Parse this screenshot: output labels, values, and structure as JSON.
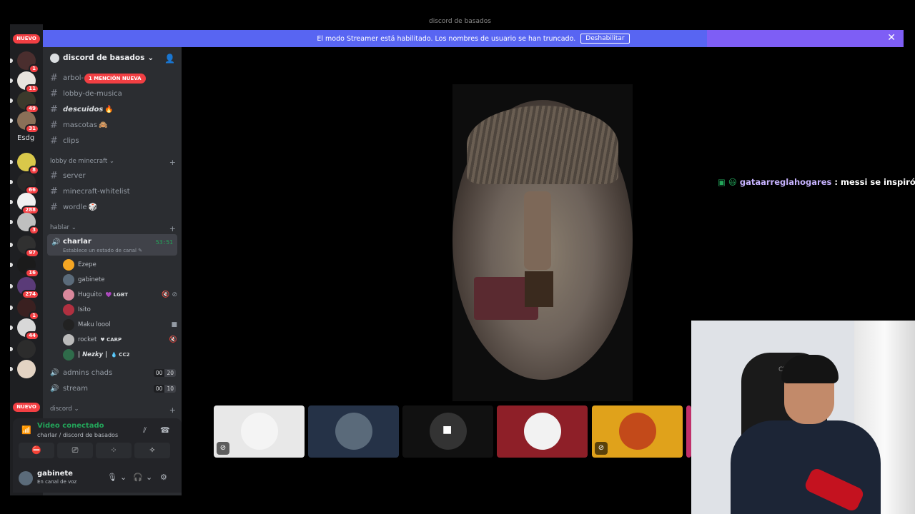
{
  "window": {
    "title": "discord de basados"
  },
  "banner": {
    "message": "El modo Streamer está habilitado. Los nombres de usuario se han truncado.",
    "button": "Deshabilitar",
    "close": "✕"
  },
  "servers": [
    {
      "badge": "1",
      "color": "#4a2e2e"
    },
    {
      "badge": "11",
      "color": "#e8e4de"
    },
    {
      "badge": "49",
      "color": "#3b3a2c"
    },
    {
      "badge": "31",
      "color": "#8a7058"
    },
    {
      "badge": "8",
      "color": "#d9c84a"
    },
    {
      "badge": "66",
      "color": "#2a2a2a"
    },
    {
      "badge": "288",
      "color": "#f0f0f0"
    },
    {
      "badge": "3",
      "color": "#bfbfbf"
    },
    {
      "badge": "97",
      "color": "#303030"
    },
    {
      "badge": "16",
      "color": "#1b1b1b"
    },
    {
      "badge": "274",
      "color": "#5a3b78"
    },
    {
      "badge": "1",
      "color": "#3a2020"
    },
    {
      "badge": "44",
      "color": "#d8d8d8"
    },
    {
      "badge": "",
      "color": "#2c2c2c"
    },
    {
      "badge": "",
      "color": "#e3d3c3"
    }
  ],
  "nuevo_label": "NUEVO",
  "folder_label": "Esdg",
  "server": {
    "name": "discord de basados"
  },
  "mention_badge": "1 MENCIÓN NUEVA",
  "channels_top": [
    {
      "name": "arbol-",
      "extra": "🎄"
    },
    {
      "name": "lobby-de-musica",
      "extra": ""
    },
    {
      "name": "descuidos",
      "extra": "🔥"
    },
    {
      "name": "mascotas",
      "extra": "🙈"
    },
    {
      "name": "clips",
      "extra": ""
    }
  ],
  "category_minecraft": {
    "label": "lobby de minecraft ⌄",
    "channels": [
      {
        "name": "server",
        "extra": ""
      },
      {
        "name": "minecraft-whitelist",
        "extra": ""
      },
      {
        "name": "wordle",
        "extra": "🎲"
      }
    ]
  },
  "category_hablar": {
    "label": "hablar ⌄"
  },
  "voice_active": {
    "name": "charlar",
    "status": "Establece un estado de canal ✎",
    "time": "53:51"
  },
  "voice_users": [
    {
      "name": "Ezepe",
      "tag": "",
      "right": "",
      "color": "#f5a623"
    },
    {
      "name": "gabinete",
      "tag": "",
      "right": "",
      "color": "#5b6b7a"
    },
    {
      "name": "Huguito",
      "tag": "💜 LGBT",
      "right": "🔇 ⊘",
      "color": "#d9889c"
    },
    {
      "name": "Isito",
      "tag": "",
      "right": "",
      "color": "#b03040"
    },
    {
      "name": "Maku loool",
      "tag": "",
      "right": "■",
      "color": "#222"
    },
    {
      "name": "rocket",
      "tag": "♥ CARP",
      "right": "🔇",
      "color": "#bbb"
    },
    {
      "name": "| Nezky |",
      "tag": "💧 CC2",
      "right": "",
      "color": "#2f6b4a"
    }
  ],
  "voice_channels": [
    {
      "name": "admins chads",
      "count": "00",
      "limit": "20"
    },
    {
      "name": "stream",
      "count": "00",
      "limit": "10"
    }
  ],
  "category_discord": {
    "label": "discord ⌄"
  },
  "connection": {
    "title": "Video conectado",
    "subtitle": "charlar / discord de basados"
  },
  "me": {
    "name": "gabinete",
    "status": "En canal de voz"
  },
  "tiles": [
    {
      "bg": "#e8e8e8",
      "av": "#f4f4f4",
      "muted": true
    },
    {
      "bg": "#253247",
      "av": "#5a6a7a",
      "muted": false
    },
    {
      "bg": "#111111",
      "av": "#333333",
      "muted": false
    },
    {
      "bg": "#8e1f28",
      "av": "#f2f2f2",
      "muted": false
    },
    {
      "bg": "#e0a21b",
      "av": "#c34a1a",
      "muted": true
    }
  ],
  "chat": {
    "icons": "▣ 😃",
    "user": "gataarreglahogares",
    "message": " : messi se inspiró en e"
  },
  "webcam": {
    "chair_text": "CR"
  }
}
